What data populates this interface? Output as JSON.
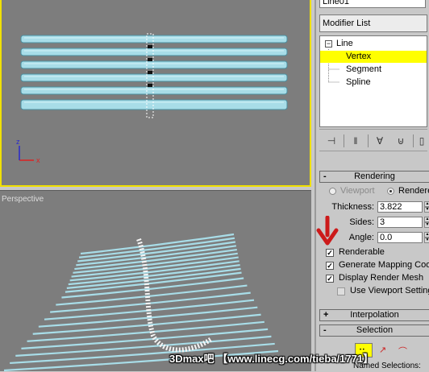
{
  "viewports": {
    "top_label": "",
    "perspective_label": "Perspective",
    "axis_x": "x",
    "axis_z": "z"
  },
  "panel": {
    "object_name": "Line01",
    "modifier_list": "Modifier List",
    "stack": [
      {
        "label": "Line",
        "expanded": true
      },
      {
        "label": "Vertex",
        "selected": true
      },
      {
        "label": "Segment"
      },
      {
        "label": "Spline"
      }
    ],
    "toolbar_icons": [
      "pin-stack-icon",
      "show-end-result-icon",
      "make-unique-icon",
      "remove-modifier-icon",
      "configure-icon"
    ],
    "rendering": {
      "collapse_sign": "-",
      "title": "Rendering",
      "viewport_label": "Viewport",
      "renderer_label": "Renderer",
      "thickness_label": "Thickness:",
      "thickness_value": "3.822",
      "sides_label": "Sides:",
      "sides_value": "3",
      "angle_label": "Angle:",
      "angle_value": "0.0",
      "renderable_label": "Renderable",
      "mapping_label": "Generate Mapping Coords",
      "display_mesh_label": "Display Render Mesh",
      "use_viewport_label": "Use Viewport Settings"
    },
    "interpolation": {
      "sign": "+",
      "title": "Interpolation"
    },
    "selection": {
      "sign": "-",
      "title": "Selection",
      "sub": "Named Selections:"
    }
  },
  "watermark": "3Dmax吧 【www.linecg.com/tieba/1771】",
  "colors": {
    "viewport_bg": "#7d7d7d",
    "wire": "#a8dde8",
    "active_border": "#f0e000",
    "selected_row": "#ffff00",
    "annotation_arrow": "#cc1a1a"
  }
}
